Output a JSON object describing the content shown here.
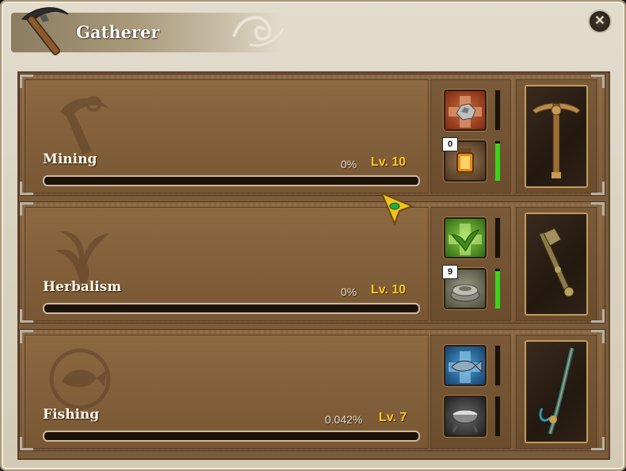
{
  "window": {
    "title": "Gatherer",
    "close_label": "✕"
  },
  "skills": [
    {
      "name": "Mining",
      "progress_text": "0%",
      "progress_fraction": 0,
      "level": "Lv. 10",
      "emblem_icon": "pickaxe-emblem-icon",
      "top_slot": {
        "icon": "ore-boost-icon",
        "color": "#c2562c",
        "gauge_fraction": 0
      },
      "bottom_slot": {
        "icon": "lantern-icon",
        "count": "0",
        "gauge_fraction": 0.95
      },
      "tool_icon": "ornate-pickaxe-icon"
    },
    {
      "name": "Herbalism",
      "progress_text": "0%",
      "progress_fraction": 0,
      "level": "Lv. 10",
      "emblem_icon": "herb-emblem-icon",
      "top_slot": {
        "icon": "herb-boost-icon",
        "color": "#5aa42c",
        "gauge_fraction": 0
      },
      "bottom_slot": {
        "icon": "stone-mortar-icon",
        "count": "9",
        "gauge_fraction": 0.95
      },
      "tool_icon": "herb-sickle-icon"
    },
    {
      "name": "Fishing",
      "progress_text": "0.042%",
      "progress_fraction": 0.00042,
      "level": "Lv. 7",
      "emblem_icon": "fish-emblem-icon",
      "top_slot": {
        "icon": "fish-boost-icon",
        "color": "#2c7fb8",
        "gauge_fraction": 0
      },
      "bottom_slot": {
        "icon": "cooking-pot-icon",
        "count": "",
        "gauge_fraction": 0
      },
      "tool_icon": "fishing-rod-icon"
    }
  ],
  "colors": {
    "level": "#ffcc1e",
    "gauge_green": "#3cd41a"
  }
}
